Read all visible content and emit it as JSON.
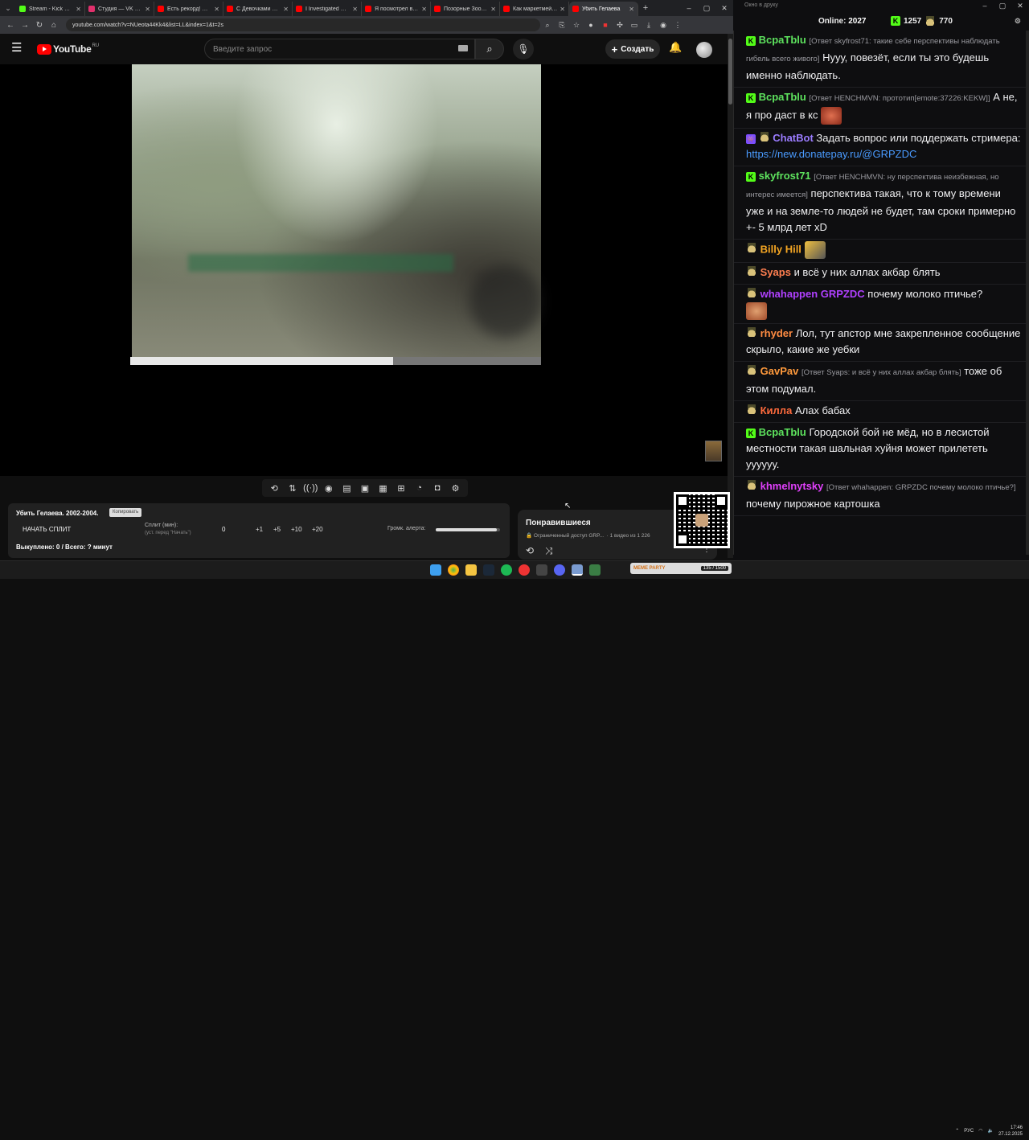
{
  "browser": {
    "tabs": [
      {
        "title": "Stream - Kick Dash",
        "color": "#53fc18",
        "active": false
      },
      {
        "title": "Студия — VK Видео",
        "color": "#e1306c",
        "active": false
      },
      {
        "title": "Есть рекорд! Пере",
        "color": "#ff0000",
        "active": false
      },
      {
        "title": "С Девочками Боль",
        "color": "#ff0000",
        "active": false
      },
      {
        "title": "I Investigated Mini",
        "color": "#ff0000",
        "active": false
      },
      {
        "title": "Я посмотрел все ф",
        "color": "#ff0000",
        "active": false
      },
      {
        "title": "Позорные Зоозащ",
        "color": "#ff0000",
        "active": false
      },
      {
        "title": "Как маркетмейкер",
        "color": "#ff0000",
        "active": false
      },
      {
        "title": "Убить Гелаева",
        "color": "#ff0000",
        "active": true
      }
    ],
    "url": "youtube.com/watch?v=NUeota44Kk4&list=LL&index=1&t=2s"
  },
  "youtube": {
    "logo_text": "YouTube",
    "region": "RU",
    "search_placeholder": "Введите запрос",
    "create_label": "Создать",
    "progress": 0.64
  },
  "split": {
    "title": "Убить Гелаева. 2002-2004.",
    "copy_label": "Копировать",
    "start_label": "НАЧАТЬ СПЛИТ",
    "split_label": "Сплит (мин):",
    "split_hint": "(уст. перед \"Начать\")",
    "value": "0",
    "increments": [
      "+1",
      "+5",
      "+10",
      "+20"
    ],
    "alert_label": "Громк. алерта:",
    "alert_volume": 0.95,
    "bought": "Выкуплено: 0 / Всего: ? минут"
  },
  "playlist": {
    "title": "Понравившиеся",
    "subtitle": "Ограниченный доступ  GRP...",
    "count": "1 видео из 1 226"
  },
  "chat": {
    "window_title": "Окно в друку",
    "online_label": "Online:",
    "online_count": "2027",
    "kick_count": "1257",
    "points_count": "770",
    "messages": [
      {
        "user": "BcpaTblu",
        "color": "#5ee35e",
        "badge": "kick",
        "reply": "[Ответ skyfrost71: такие себе перспективы наблюдать гибель всего живого]",
        "text": "Нууу, повезёт, если ты это будешь именно наблюдать."
      },
      {
        "user": "BcpaTblu",
        "color": "#5ee35e",
        "badge": "kick",
        "reply": "[Ответ HENCHMVN: прототип[emote:37226:KEKW]]",
        "text": "А не, я про даст в кс"
      },
      {
        "user": "ChatBot",
        "color": "#9b7cff",
        "badge": "bot",
        "reply": "",
        "text": "Задать вопрос или поддержать стримера:",
        "link": "https://new.donatepay.ru/@GRPZDC"
      },
      {
        "user": "skyfrost71",
        "color": "#5ee35e",
        "badge": "kick",
        "reply": "[Ответ HENCHMVN: ну перспектива неизбежная, но интерес имеется]",
        "text": "перспектива такая, что к тому времени уже и на земле-то людей не будет, там сроки примерно +- 5 млрд лет xD"
      },
      {
        "user": "Billy Hill",
        "color": "#f5a623",
        "badge": "hat",
        "reply": "",
        "text": ""
      },
      {
        "user": "Syaps",
        "color": "#ff7f50",
        "badge": "hat",
        "reply": "",
        "text": "и всё у них аллах акбар блять"
      },
      {
        "user": "whahappen",
        "color": "#b040ff",
        "badge": "hat",
        "reply": "",
        "mention": "GRPZDC",
        "text": "почему молоко птичье?"
      },
      {
        "user": "rhyder",
        "color": "#ff8c42",
        "badge": "hat",
        "reply": "",
        "text": "Лол, тут апстор мне закрепленное сообщение скрыло, какие же уебки"
      },
      {
        "user": "GavPav",
        "color": "#ff9a3c",
        "badge": "hat",
        "reply": "[Ответ Syaps: и всё у них аллах акбар блять]",
        "text": "тоже об этом подумал."
      },
      {
        "user": "Килла",
        "color": "#ff6b3d",
        "badge": "hat",
        "reply": "",
        "text": "Алах бабах"
      },
      {
        "user": "BcpaTblu",
        "color": "#5ee35e",
        "badge": "kick",
        "reply": "",
        "text": "Городской бой не мёд, но в лесистой местности такая шальная хуйня может прилететь уууууу."
      },
      {
        "user": "khmelnytsky",
        "color": "#e040fb",
        "badge": "hat",
        "reply": "[Ответ whahappen: GRPZDC почему молоко птичье?]",
        "text": "почему пирожное картошка"
      }
    ]
  },
  "taskbar": {
    "widget_label": "MEME PARTY",
    "widget_count": "135 / 1500",
    "lang": "РУС",
    "time": "17:46",
    "date": "27.12.2025"
  }
}
